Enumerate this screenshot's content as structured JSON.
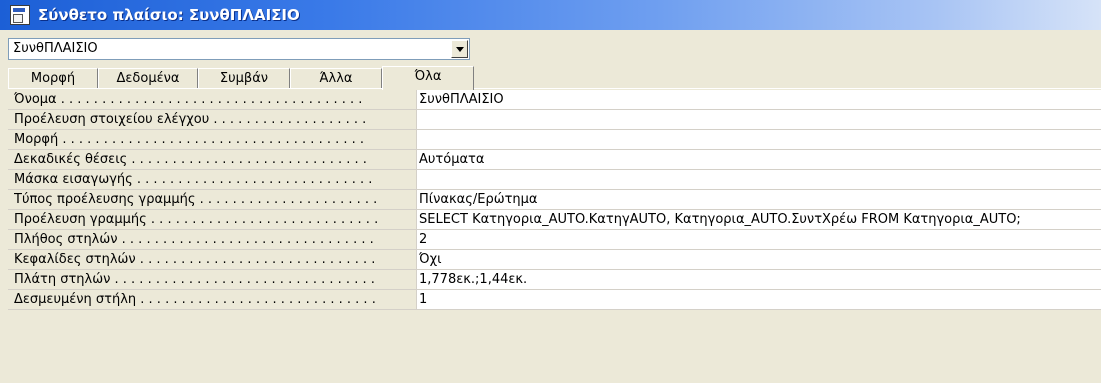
{
  "window": {
    "title": "Σύνθετο πλαίσιο: ΣυνθΠΛΑΙΣΙΟ"
  },
  "selector": {
    "value": "ΣυνθΠΛΑΙΣΙΟ"
  },
  "tabs": [
    {
      "label": "Μορφή"
    },
    {
      "label": "Δεδομένα"
    },
    {
      "label": "Συμβάν"
    },
    {
      "label": "Άλλα"
    },
    {
      "label": "Όλα"
    }
  ],
  "properties": [
    {
      "label": "Όνομα . . . . . . . . . . . . . . . . . . . . . . . . . . . . . . . . . . . . .",
      "value": "ΣυνθΠΛΑΙΣΙΟ"
    },
    {
      "label": "Προέλευση στοιχείου ελέγχου . . . . . . . . . . . . . . . . . . .",
      "value": ""
    },
    {
      "label": "Μορφή . . . . . . . . . . . . . . . . . . . . . . . . . . . . . . . . . . . . .",
      "value": ""
    },
    {
      "label": "Δεκαδικές θέσεις . . . . . . . . . . . . . . . . . . . . . . . . . . . . .",
      "value": "Αυτόματα"
    },
    {
      "label": "Μάσκα εισαγωγής . . . . . . . . . . . . . . . . . . . . . . . . . . . . .",
      "value": ""
    },
    {
      "label": "Τύπος προέλευσης γραμμής . . . . . . . . . . . . . . . . . . . . . .",
      "value": "Πίνακας/Ερώτημα"
    },
    {
      "label": "Προέλευση γραμμής . . . . . . . . . . . . . . . . . . . . . . . . . . . .",
      "value": "SELECT Κατηγορια_AUTO.ΚατηγAUTO, Κατηγορια_AUTO.ΣυντΧρέω FROM Κατηγορια_AUTO;"
    },
    {
      "label": "Πλήθος στηλών . . . . . . . . . . . . . . . . . . . . . . . . . . . . . . .",
      "value": "2"
    },
    {
      "label": "Κεφαλίδες στηλών . . . . . . . . . . . . . . . . . . . . . . . . . . . . .",
      "value": "Όχι"
    },
    {
      "label": "Πλάτη στηλών . . . . . . . . . . . . . . . . . . . . . . . . . . . . . . . .",
      "value": "1,778εκ.;1,44εκ."
    },
    {
      "label": "Δεσμευμένη στήλη . . . . . . . . . . . . . . . . . . . . . . . . . . . . .",
      "value": "1"
    }
  ]
}
